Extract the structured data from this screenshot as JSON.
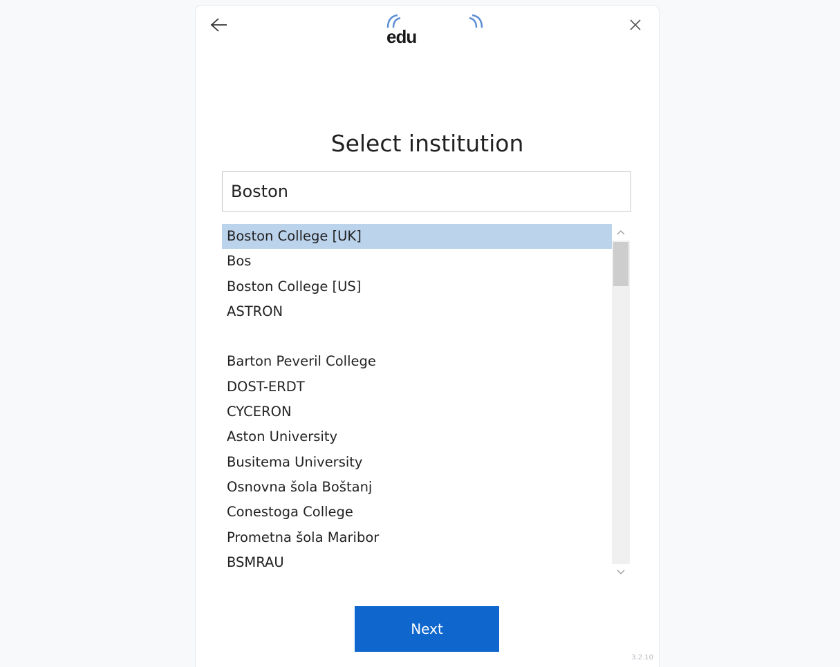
{
  "header": {
    "logo_text": "edu",
    "back_icon": "arrow-left-icon",
    "close_icon": "close-icon"
  },
  "main": {
    "title": "Select institution",
    "search_value": "Boston",
    "institutions": [
      "Boston College [UK]",
      "Bos",
      "Boston College [US]",
      "ASTRON",
      "",
      "Barton Peveril College",
      "DOST-ERDT",
      "CYCERON",
      "Aston University",
      "Busitema University",
      "Osnovna šola Boštanj",
      "Conestoga College",
      "Prometna šola Maribor",
      "BSMRAU"
    ],
    "selected_index": 0
  },
  "footer": {
    "next_label": "Next",
    "version": "3.2.10"
  },
  "colors": {
    "accent": "#0f66cc",
    "selected_row": "#bcd3ec"
  }
}
